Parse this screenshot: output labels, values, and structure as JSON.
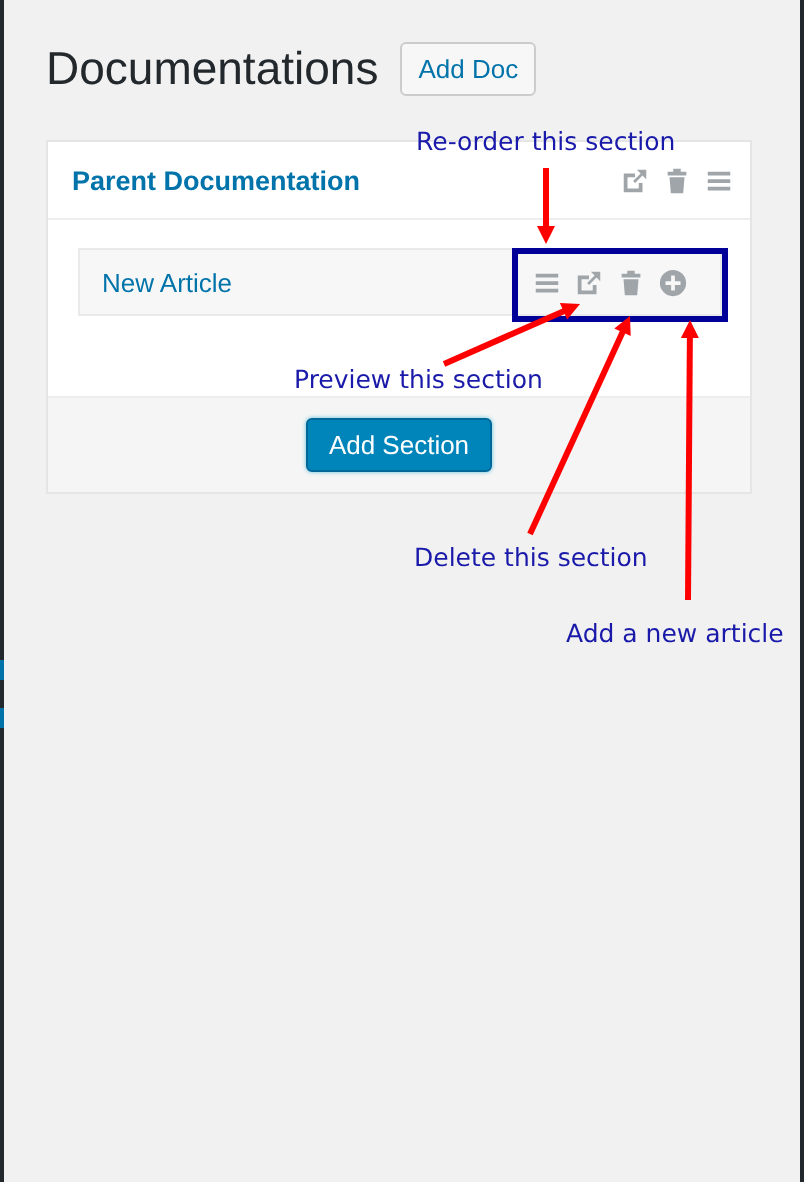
{
  "page": {
    "title": "Documentations",
    "add_button": "Add Doc"
  },
  "docs": [
    {
      "title": "Parent Documentation",
      "articles": [
        {
          "title": "New Article"
        }
      ]
    }
  ],
  "add_section_button": "Add Section",
  "annotations": [
    {
      "text": "Re-order this section"
    },
    {
      "text": "Preview this section"
    },
    {
      "text": "Delete this section"
    },
    {
      "text": "Add a new article"
    }
  ]
}
